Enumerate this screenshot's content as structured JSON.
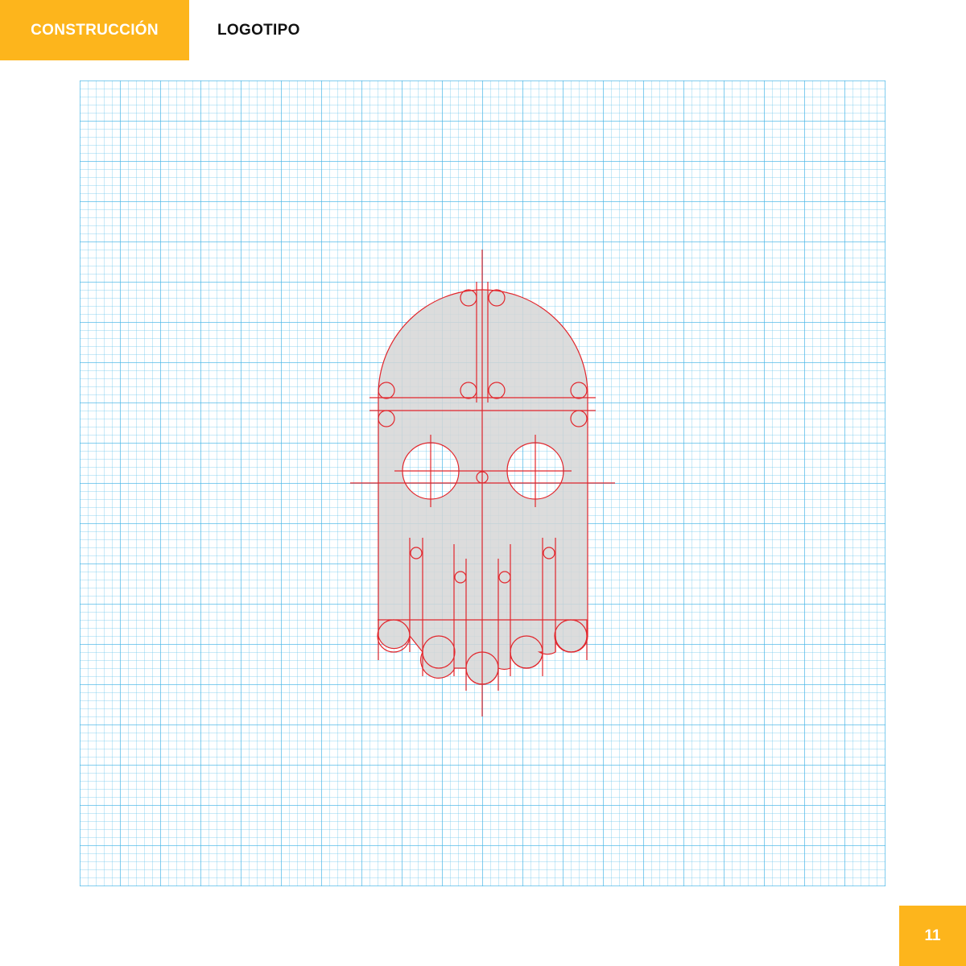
{
  "header": {
    "section_label": "CONSTRUCCIÓN",
    "title": "LOGOTIPO"
  },
  "footer": {
    "page_number": "11"
  },
  "colors": {
    "accent": "#FDB51C",
    "construction_line": "#E2262C",
    "shape_fill": "#D6D6D6",
    "grid_line": "#7CC9EC"
  },
  "figure": {
    "icon": "ghost-logo-construction"
  }
}
